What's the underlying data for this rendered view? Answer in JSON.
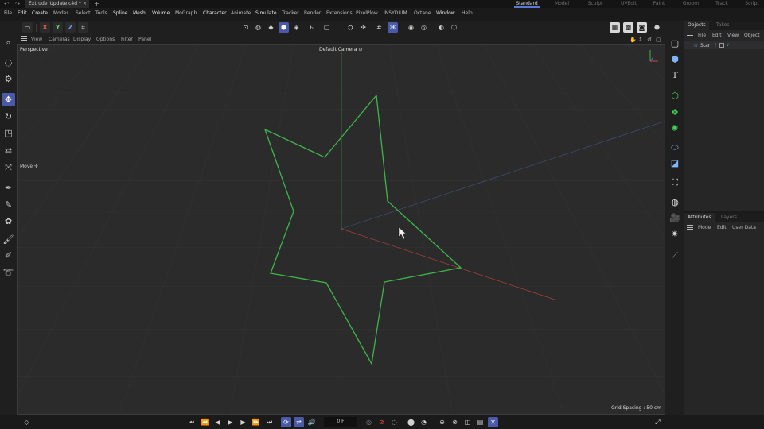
{
  "title_bar": {
    "document_tab": "Extrude_Update.c4d *",
    "close_glyph": "×",
    "new_tab_glyph": "+",
    "layouts": [
      "Standard",
      "Model",
      "Sculpt",
      "UVEdit",
      "Paint",
      "Groom",
      "Track",
      "Script"
    ]
  },
  "menu": [
    "File",
    "Edit",
    "Create",
    "Modes",
    "Select",
    "Tools",
    "Spline",
    "Mesh",
    "Volume",
    "MoGraph",
    "Character",
    "Animate",
    "Simulate",
    "Tracker",
    "Render",
    "Extensions",
    "PixelPlow",
    "INSYDIUM",
    "Octane",
    "Window",
    "Help"
  ],
  "toolbar": {
    "axis_x": "X",
    "axis_y": "Y",
    "axis_z": "Z"
  },
  "viewport": {
    "menu": [
      "View",
      "Cameras",
      "Display",
      "Options",
      "Filter",
      "Panel"
    ],
    "projection_label": "Perspective",
    "camera_label": "Default Camera",
    "camera_glyph": "⊙",
    "tool_label": "Move",
    "tool_glyph": "✛",
    "grid_spacing": "Grid Spacing : 50 cm",
    "spline_color": "#3fb54a"
  },
  "objects_panel": {
    "tabs": [
      "Objects",
      "Takes"
    ],
    "menu": [
      "File",
      "Edit",
      "View",
      "Object"
    ],
    "rows": [
      {
        "name": "Star",
        "enabled_glyph": "✓"
      }
    ]
  },
  "attributes_panel": {
    "tabs": [
      "Attributes",
      "Layers"
    ],
    "menu": [
      "Mode",
      "Edit",
      "User Data"
    ]
  },
  "timeline": {
    "current_frame": "0 F"
  },
  "colors": {
    "accent": "#4a5aa8",
    "viewport_bg": "#2b2b2c",
    "spline": "#3fb54a",
    "axis_x": "#c8473f",
    "axis_y": "#3fb54a",
    "axis_z": "#5a78d6"
  }
}
